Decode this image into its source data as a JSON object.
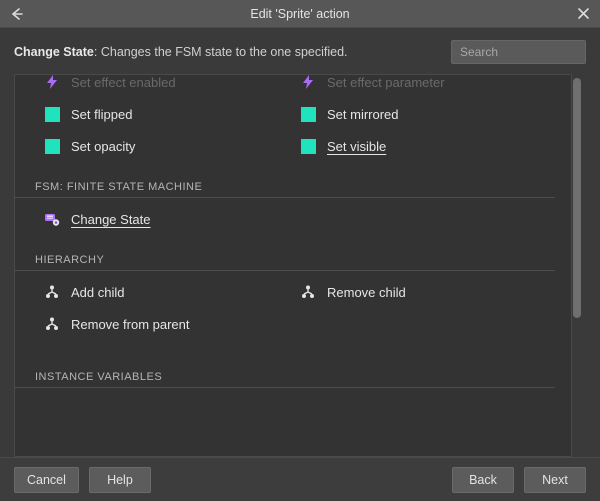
{
  "window": {
    "title": "Edit 'Sprite' action"
  },
  "header": {
    "desc_bold": "Change State",
    "desc_rest": ": Changes the FSM state to the one specified.",
    "search_placeholder": "Search"
  },
  "sections": {
    "appearance_partial": {
      "items": [
        {
          "label": "Set effect enabled"
        },
        {
          "label": "Set effect parameter"
        },
        {
          "label": "Set flipped"
        },
        {
          "label": "Set mirrored"
        },
        {
          "label": "Set opacity"
        },
        {
          "label": "Set visible"
        }
      ]
    },
    "fsm": {
      "title": "FSM: FINITE STATE MACHINE",
      "items": [
        {
          "label": "Change State"
        }
      ]
    },
    "hierarchy": {
      "title": "HIERARCHY",
      "items": [
        {
          "label": "Add child"
        },
        {
          "label": "Remove child"
        },
        {
          "label": "Remove from parent"
        }
      ]
    },
    "instance_vars": {
      "title": "INSTANCE VARIABLES"
    }
  },
  "footer": {
    "cancel": "Cancel",
    "help": "Help",
    "back": "Back",
    "next": "Next"
  }
}
